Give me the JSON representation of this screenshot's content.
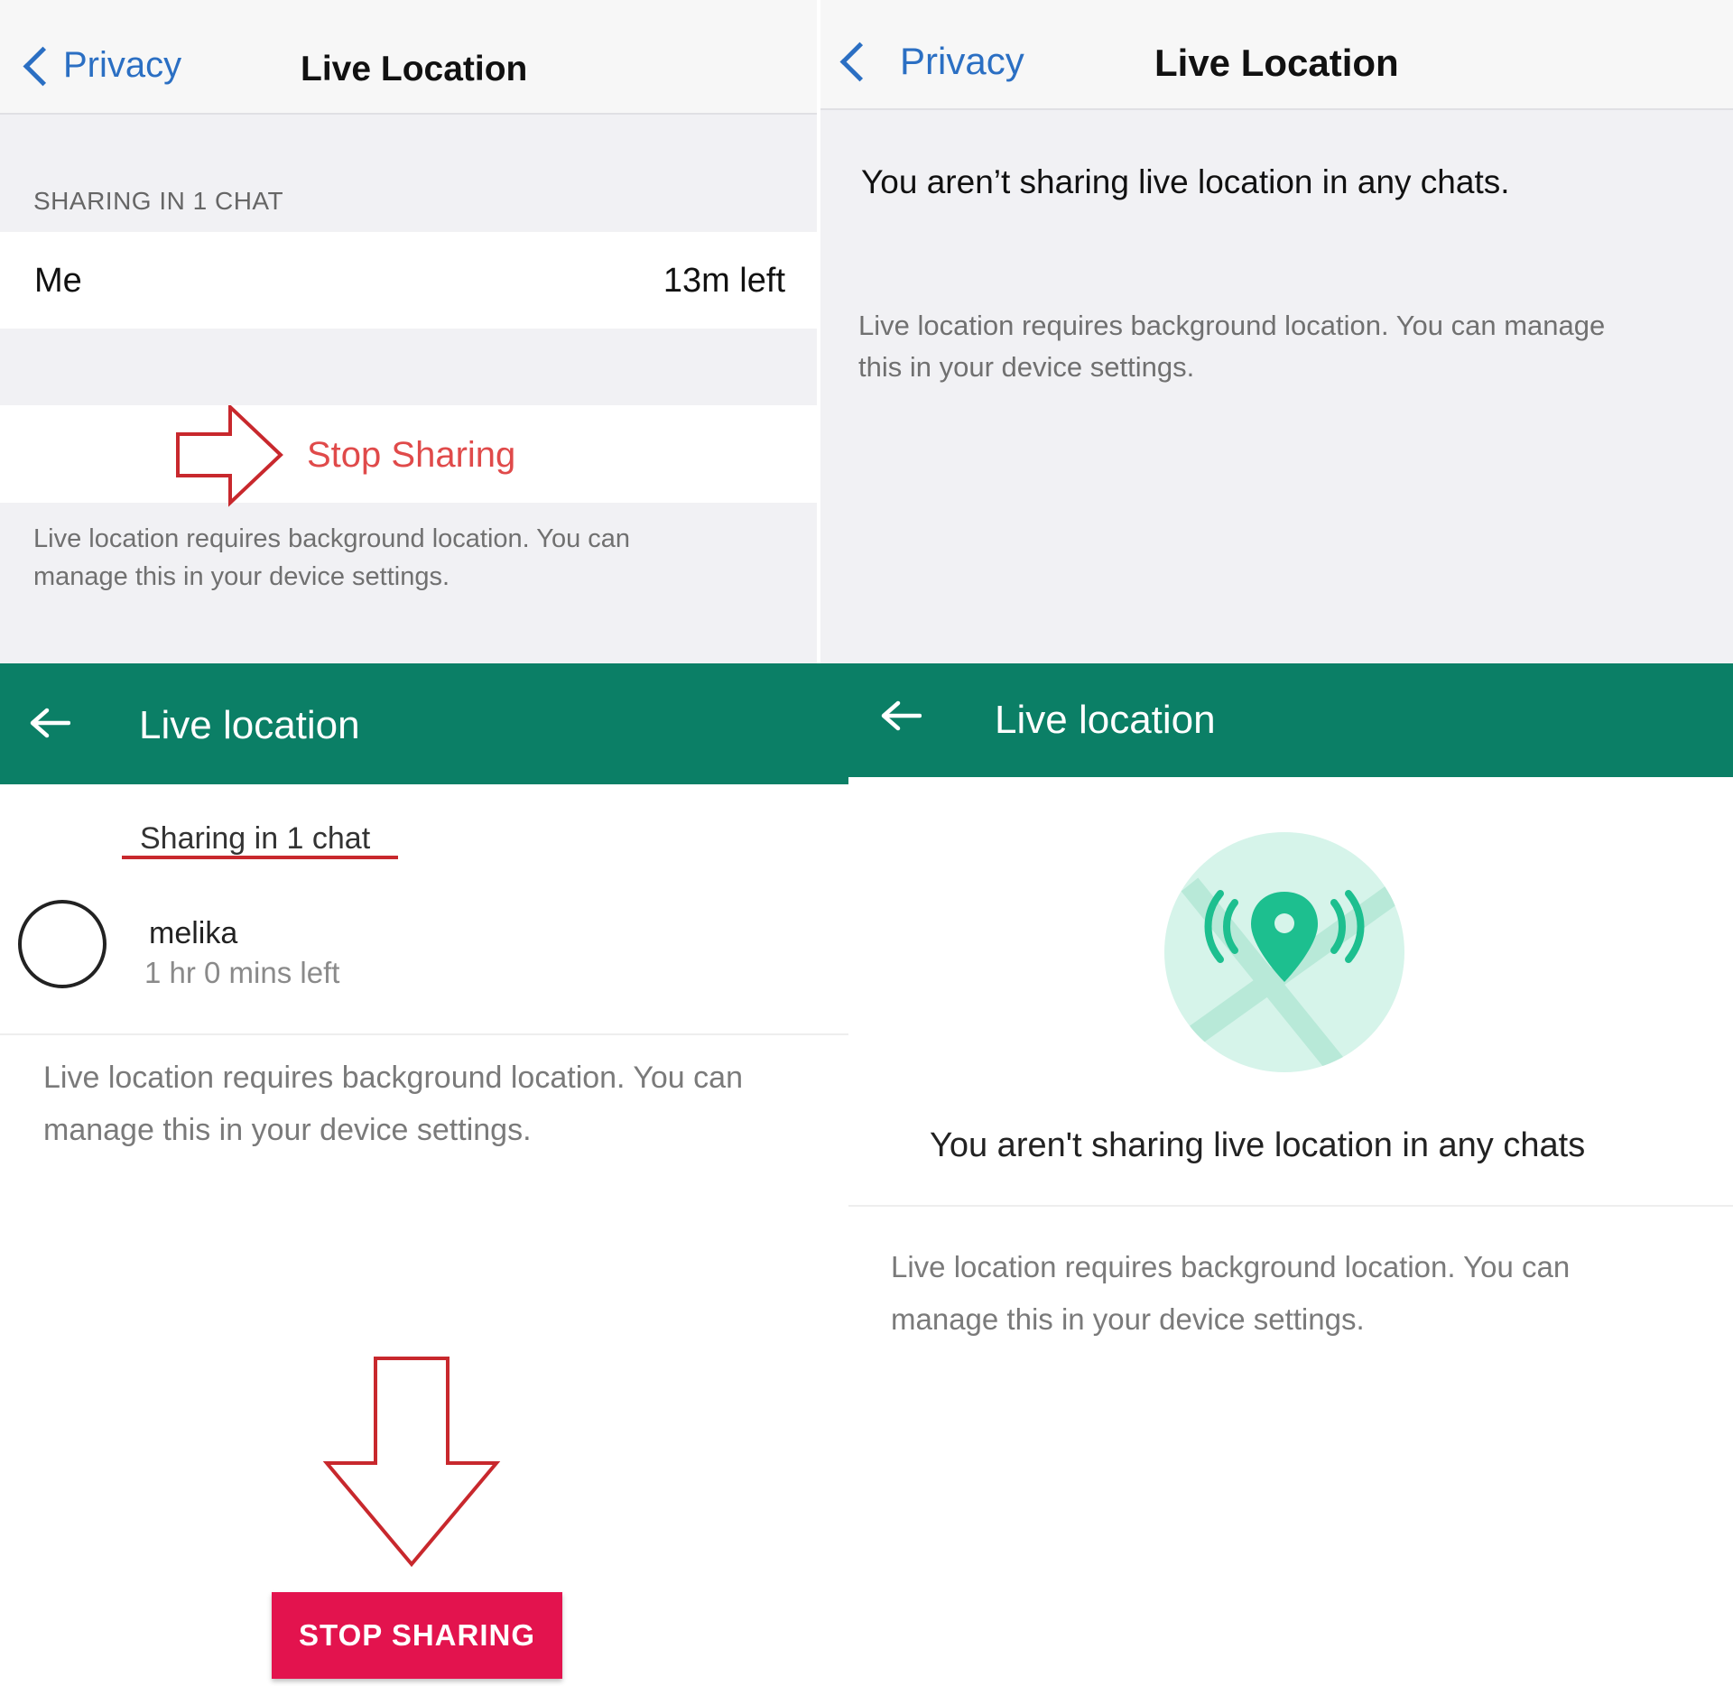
{
  "ios_sharing": {
    "back_label": "Privacy",
    "title": "Live Location",
    "section_header": "SHARING IN 1 CHAT",
    "row_name": "Me",
    "row_time": "13m left",
    "stop_label": "Stop Sharing",
    "footer": "Live location requires background location. You can manage this in your device settings."
  },
  "ios_empty": {
    "back_label": "Privacy",
    "title": "Live Location",
    "message": "You aren’t sharing live location in any chats.",
    "footer": "Live location requires background location. You can manage this in your device settings."
  },
  "android_sharing": {
    "title": "Live location",
    "section_header": "Sharing in 1 chat",
    "contact_name": "melika",
    "contact_time": "1 hr 0 mins left",
    "footer": "Live location requires background location. You can manage this in your device settings.",
    "stop_label": "STOP SHARING"
  },
  "android_empty": {
    "title": "Live location",
    "message": "You aren't sharing live location in any chats",
    "footer": "Live location requires background location. You can manage this in your device settings."
  },
  "colors": {
    "ios_link": "#2b6fc3",
    "ios_destructive": "#e04a4a",
    "android_appbar": "#0b7f66",
    "android_stop_button": "#e3134e",
    "annotation_red": "#c8282d",
    "illustration_circle": "#d6f4ea",
    "illustration_pin": "#1dbf8f"
  },
  "icons": [
    "chevron-left-icon",
    "arrow-left-icon",
    "live-location-pin-icon",
    "annotation-arrow-right",
    "annotation-arrow-down"
  ]
}
